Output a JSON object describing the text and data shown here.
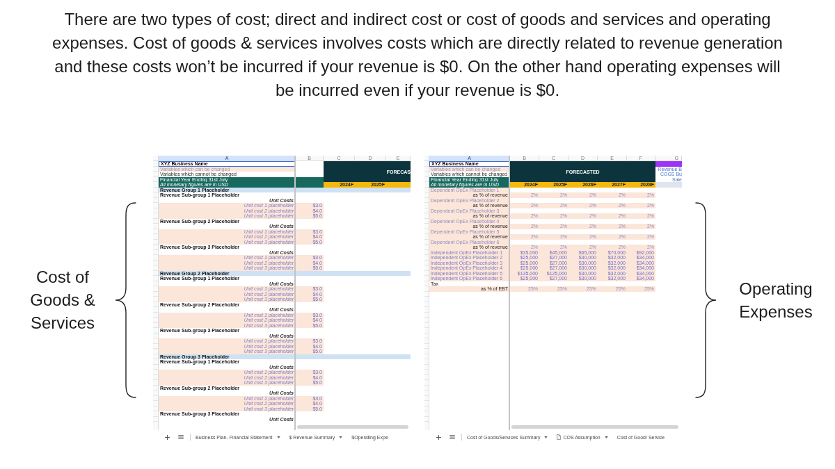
{
  "intro": "There are two types of cost; direct and indirect cost or cost of goods and services and operating expenses. Cost of goods & services involves costs which are directly related to revenue generation and these costs won’t be incurred if your revenue is $0. On the other hand operating expenses will be incurred even if your revenue is $0.",
  "left_label": "Cost of Goods & Services",
  "sheets": [
    {
      "columns": [
        {
          "label": "A",
          "selected": true
        },
        {
          "label": "B",
          "selected": false
        },
        {
          "label": "C",
          "selected": false
        },
        {
          "label": "D",
          "selected": false
        },
        {
          "label": "E",
          "selected": false
        }
      ],
      "title_cell": {
        "text": "XYZ Business Name",
        "selected": true
      },
      "notes": [
        {
          "kind": "editable_note",
          "text": "Variables which can be changed"
        },
        {
          "kind": "fixed_note",
          "text": "Variables which cannot be changed"
        },
        {
          "kind": "banner",
          "text": "Financial Year Ending 31st July"
        },
        {
          "kind": "banner_italic",
          "text": "All monetary figures are in USD"
        }
      ],
      "forecast": {
        "label": "FORECAS",
        "years": [
          "2024F",
          "2025F"
        ]
      },
      "rows": [
        {
          "kind": "group",
          "cells": [
            "Revenue Group 1 Placeholder"
          ]
        },
        {
          "kind": "subgroup",
          "cells": [
            "Revenue Sub-group 1 Placeholder"
          ]
        },
        {
          "kind": "subheading",
          "cells": [
            "Unit Costs"
          ]
        },
        {
          "kind": "input",
          "cells": [
            "Unit cost 1 placeholder",
            "$3.0"
          ]
        },
        {
          "kind": "input",
          "cells": [
            "Unit cost 2 placeholder",
            "$4.0"
          ]
        },
        {
          "kind": "input",
          "cells": [
            "Unit cost 3 placeholder",
            "$5.0"
          ]
        },
        {
          "kind": "subgroup",
          "cells": [
            "Revenue Sub-group 2 Placeholder"
          ]
        },
        {
          "kind": "subheading",
          "cells": [
            "Unit Costs"
          ]
        },
        {
          "kind": "input",
          "cells": [
            "Unit cost 1 placeholder",
            "$3.0"
          ]
        },
        {
          "kind": "input",
          "cells": [
            "Unit cost 2 placeholder",
            "$4.0"
          ]
        },
        {
          "kind": "input",
          "cells": [
            "Unit cost 3 placeholder",
            "$5.0"
          ]
        },
        {
          "kind": "subgroup",
          "cells": [
            "Revenue Sub-group 3 Placeholder"
          ]
        },
        {
          "kind": "subheading",
          "cells": [
            "Unit Costs"
          ]
        },
        {
          "kind": "input",
          "cells": [
            "Unit cost 1 placeholder",
            "$3.0"
          ]
        },
        {
          "kind": "input",
          "cells": [
            "Unit cost 2 placeholder",
            "$4.0"
          ]
        },
        {
          "kind": "input",
          "cells": [
            "Unit cost 3 placeholder",
            "$5.0"
          ]
        },
        {
          "kind": "group",
          "cells": [
            "Revenue Group 2 Placeholder"
          ]
        },
        {
          "kind": "subgroup",
          "cells": [
            "Revenue Sub-group 1 Placeholder"
          ]
        },
        {
          "kind": "subheading",
          "cells": [
            "Unit Costs"
          ]
        },
        {
          "kind": "input",
          "cells": [
            "Unit cost 1 placeholder",
            "$3.0"
          ]
        },
        {
          "kind": "input",
          "cells": [
            "Unit cost 2 placeholder",
            "$4.0"
          ]
        },
        {
          "kind": "input",
          "cells": [
            "Unit cost 3 placeholder",
            "$5.0"
          ]
        },
        {
          "kind": "subgroup",
          "cells": [
            "Revenue Sub-group 2 Placeholder"
          ]
        },
        {
          "kind": "subheading",
          "cells": [
            "Unit Costs"
          ]
        },
        {
          "kind": "input",
          "cells": [
            "Unit cost 1 placeholder",
            "$3.0"
          ]
        },
        {
          "kind": "input",
          "cells": [
            "Unit cost 2 placeholder",
            "$4.0"
          ]
        },
        {
          "kind": "input",
          "cells": [
            "Unit cost 3 placeholder",
            "$5.0"
          ]
        },
        {
          "kind": "subgroup",
          "cells": [
            "Revenue Sub-group 3 Placeholder"
          ]
        },
        {
          "kind": "subheading",
          "cells": [
            "Unit Costs"
          ]
        },
        {
          "kind": "input",
          "cells": [
            "Unit cost 1 placeholder",
            "$3.0"
          ]
        },
        {
          "kind": "input",
          "cells": [
            "Unit cost 2 placeholder",
            "$4.0"
          ]
        },
        {
          "kind": "input",
          "cells": [
            "Unit cost 3 placeholder",
            "$5.0"
          ]
        },
        {
          "kind": "group",
          "cells": [
            "Revenue Group 3 Placeholder"
          ]
        },
        {
          "kind": "subgroup",
          "cells": [
            "Revenue Sub-group 1 Placeholder"
          ]
        },
        {
          "kind": "subheading",
          "cells": [
            "Unit Costs"
          ]
        },
        {
          "kind": "input",
          "cells": [
            "Unit cost 1 placeholder",
            "$3.0"
          ]
        },
        {
          "kind": "input",
          "cells": [
            "Unit cost 2 placeholder",
            "$4.0"
          ]
        },
        {
          "kind": "input",
          "cells": [
            "Unit cost 3 placeholder",
            "$5.0"
          ]
        },
        {
          "kind": "subgroup",
          "cells": [
            "Revenue Sub-group 2 Placeholder"
          ]
        },
        {
          "kind": "subheading",
          "cells": [
            "Unit Costs"
          ]
        },
        {
          "kind": "input",
          "cells": [
            "Unit cost 1 placeholder",
            "$3.0"
          ]
        },
        {
          "kind": "input",
          "cells": [
            "Unit cost 2 placeholder",
            "$4.0"
          ]
        },
        {
          "kind": "input",
          "cells": [
            "Unit cost 3 placeholder",
            "$5.0"
          ]
        },
        {
          "kind": "subgroup",
          "cells": [
            "Revenue Sub-group 3 Placeholder"
          ]
        },
        {
          "kind": "subheading",
          "cells": [
            "Unit Costs"
          ]
        }
      ],
      "tabs": [
        {
          "label": "Business Plan- Financial Statement",
          "kind": "plain",
          "dropdown": true,
          "selected": false
        },
        {
          "label": "$ Revenue Summary",
          "kind": "plain",
          "dropdown": true,
          "selected": false
        },
        {
          "label": "$Operating Expe",
          "kind": "plain",
          "dropdown": false,
          "selected": false
        }
      ]
    },
    {
      "columns": [
        {
          "label": "A",
          "selected": true
        },
        {
          "label": "B",
          "selected": false
        },
        {
          "label": "C",
          "selected": false
        },
        {
          "label": "D",
          "selected": false
        },
        {
          "label": "E",
          "selected": false
        },
        {
          "label": "F",
          "selected": false
        },
        {
          "label": "G",
          "selected": false
        }
      ],
      "title_cell": {
        "text": "XYZ Business Name",
        "selected": true
      },
      "notes": [
        {
          "kind": "editable_note",
          "text": "Variables which can be changed"
        },
        {
          "kind": "fixed_note",
          "text": "Variables which cannot be changed"
        },
        {
          "kind": "banner",
          "text": "Financial Year Ending 31st July"
        },
        {
          "kind": "banner_italic",
          "text": "All monetary figures are in USD"
        }
      ],
      "forecast": {
        "label": "FORECASTED",
        "years": [
          "2024F",
          "2025F",
          "2026F",
          "2027F",
          "2028F"
        ]
      },
      "side_panel": {
        "links": [
          "Revenue B",
          "COGS Bu",
          "Sale"
        ]
      },
      "rows": [
        {
          "kind": "dependent",
          "cells": [
            "Dependent OpEx Placeholder 1"
          ]
        },
        {
          "kind": "ratio",
          "cells": [
            "as % of revenue",
            "2%",
            "2%",
            "2%",
            "2%",
            "2%"
          ]
        },
        {
          "kind": "dependent",
          "cells": [
            "Dependent OpEx Placeholder 2"
          ]
        },
        {
          "kind": "ratio",
          "cells": [
            "as % of revenue",
            "2%",
            "2%",
            "2%",
            "2%",
            "2%"
          ]
        },
        {
          "kind": "dependent",
          "cells": [
            "Dependent OpEx Placeholder 3"
          ]
        },
        {
          "kind": "ratio",
          "cells": [
            "as % of revenue",
            "2%",
            "2%",
            "2%",
            "2%",
            "2%"
          ]
        },
        {
          "kind": "dependent",
          "cells": [
            "Dependent OpEx Placeholder 4"
          ]
        },
        {
          "kind": "ratio",
          "cells": [
            "as % of revenue",
            "2%",
            "2%",
            "2%",
            "2%",
            "2%"
          ]
        },
        {
          "kind": "dependent",
          "cells": [
            "Dependent OpEx Placeholder 5"
          ]
        },
        {
          "kind": "ratio",
          "cells": [
            "as % of revenue",
            "2%",
            "2%",
            "2%",
            "2%",
            "2%"
          ]
        },
        {
          "kind": "dependent",
          "cells": [
            "Dependent OpEx Placeholder 6"
          ]
        },
        {
          "kind": "ratio",
          "cells": [
            "as % of revenue",
            "2%",
            "2%",
            "2%",
            "2%",
            "2%"
          ]
        },
        {
          "kind": "independent",
          "cells": [
            "Independent OpEx Placeholder 1",
            "$35,000",
            "$45,000",
            "$65,000",
            "$70,000",
            "$92,000"
          ]
        },
        {
          "kind": "independent",
          "cells": [
            "Independent OpEx Placeholder 2",
            "$25,000",
            "$27,000",
            "$30,000",
            "$32,000",
            "$34,000"
          ]
        },
        {
          "kind": "independent",
          "cells": [
            "Independent OpEx Placeholder 3",
            "$25,000",
            "$27,000",
            "$30,000",
            "$32,000",
            "$34,000"
          ]
        },
        {
          "kind": "independent",
          "cells": [
            "Independent OpEx Placeholder 4",
            "$25,000",
            "$27,000",
            "$30,000",
            "$32,000",
            "$34,000"
          ]
        },
        {
          "kind": "independent",
          "cells": [
            "Independent OpEx Placeholder 5",
            "$135,000",
            "$125,000",
            "$30,000",
            "$32,000",
            "$34,000"
          ]
        },
        {
          "kind": "independent",
          "cells": [
            "Independent OpEx Placeholder 6",
            "$25,000",
            "$27,000",
            "$30,000",
            "$32,000",
            "$34,000"
          ]
        },
        {
          "kind": "section",
          "cells": [
            "Tax"
          ]
        },
        {
          "kind": "ratio",
          "cells": [
            "as % of EBT",
            "25%",
            "25%",
            "25%",
            "25%",
            "25%"
          ]
        }
      ],
      "tabs": [
        {
          "label": "Cost of Goods/Services Summary",
          "kind": "plain",
          "dropdown": true,
          "selected": false
        },
        {
          "label": "COS Assumption",
          "kind": "document",
          "dropdown": true,
          "selected": false
        },
        {
          "label": "Cost of Good/ Service",
          "kind": "plain",
          "dropdown": false,
          "selected": false
        }
      ]
    }
  ],
  "right_label": "Operating Expenses"
}
